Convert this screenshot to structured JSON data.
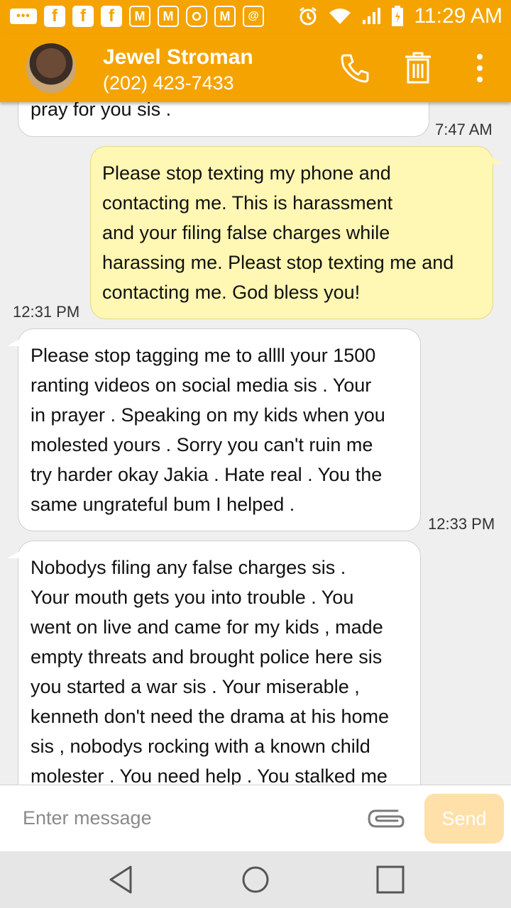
{
  "status_bar": {
    "time": "11:29 AM",
    "left_icons": [
      "more-notifications-icon",
      "facebook-icon",
      "facebook-icon",
      "facebook-icon",
      "gmail-icon",
      "gmail-icon",
      "instagram-icon",
      "gmail-icon",
      "email-icon"
    ],
    "right_icons": [
      "alarm-icon",
      "wifi-icon",
      "signal-icon",
      "battery-icon"
    ]
  },
  "contact": {
    "name": "Jewel Stroman",
    "number": "(202) 423-7433"
  },
  "messages": [
    {
      "direction": "in",
      "text": "pray for you sis .",
      "time": "7:47 AM"
    },
    {
      "direction": "out",
      "lines": [
        "Please stop texting my phone and",
        "contacting me. This is harassment",
        "and your filing false charges while",
        "harassing me. Pleast stop texting me and",
        "contacting me. God bless you!"
      ],
      "time": "12:31 PM"
    },
    {
      "direction": "in",
      "lines": [
        "Please stop tagging me to allll your 1500",
        "ranting videos on social media sis . Your",
        "in prayer . Speaking on my kids when you",
        "molested yours . Sorry you can't ruin me",
        "try harder okay Jakia . Hate real . You the",
        "same ungrateful bum I helped ."
      ],
      "time": "12:33 PM"
    },
    {
      "direction": "in",
      "lines": [
        "Nobodys filing any false charges sis .",
        "Your mouth gets you into trouble . You",
        "went on live and came for my kids , made",
        "empty threats and brought police here sis",
        "you started a war sis . Your miserable ,",
        "kenneth don't need the drama at his home",
        "sis , nobodys rocking with a known child",
        "molester . You need help . You stalked me"
      ]
    }
  ],
  "composer": {
    "placeholder": "Enter message",
    "send_label": "Send"
  },
  "colors": {
    "header": "#f5a300",
    "outgoing_bubble": "#fff7b3",
    "incoming_bubble": "#ffffff",
    "send_button": "#ffe0a8"
  }
}
